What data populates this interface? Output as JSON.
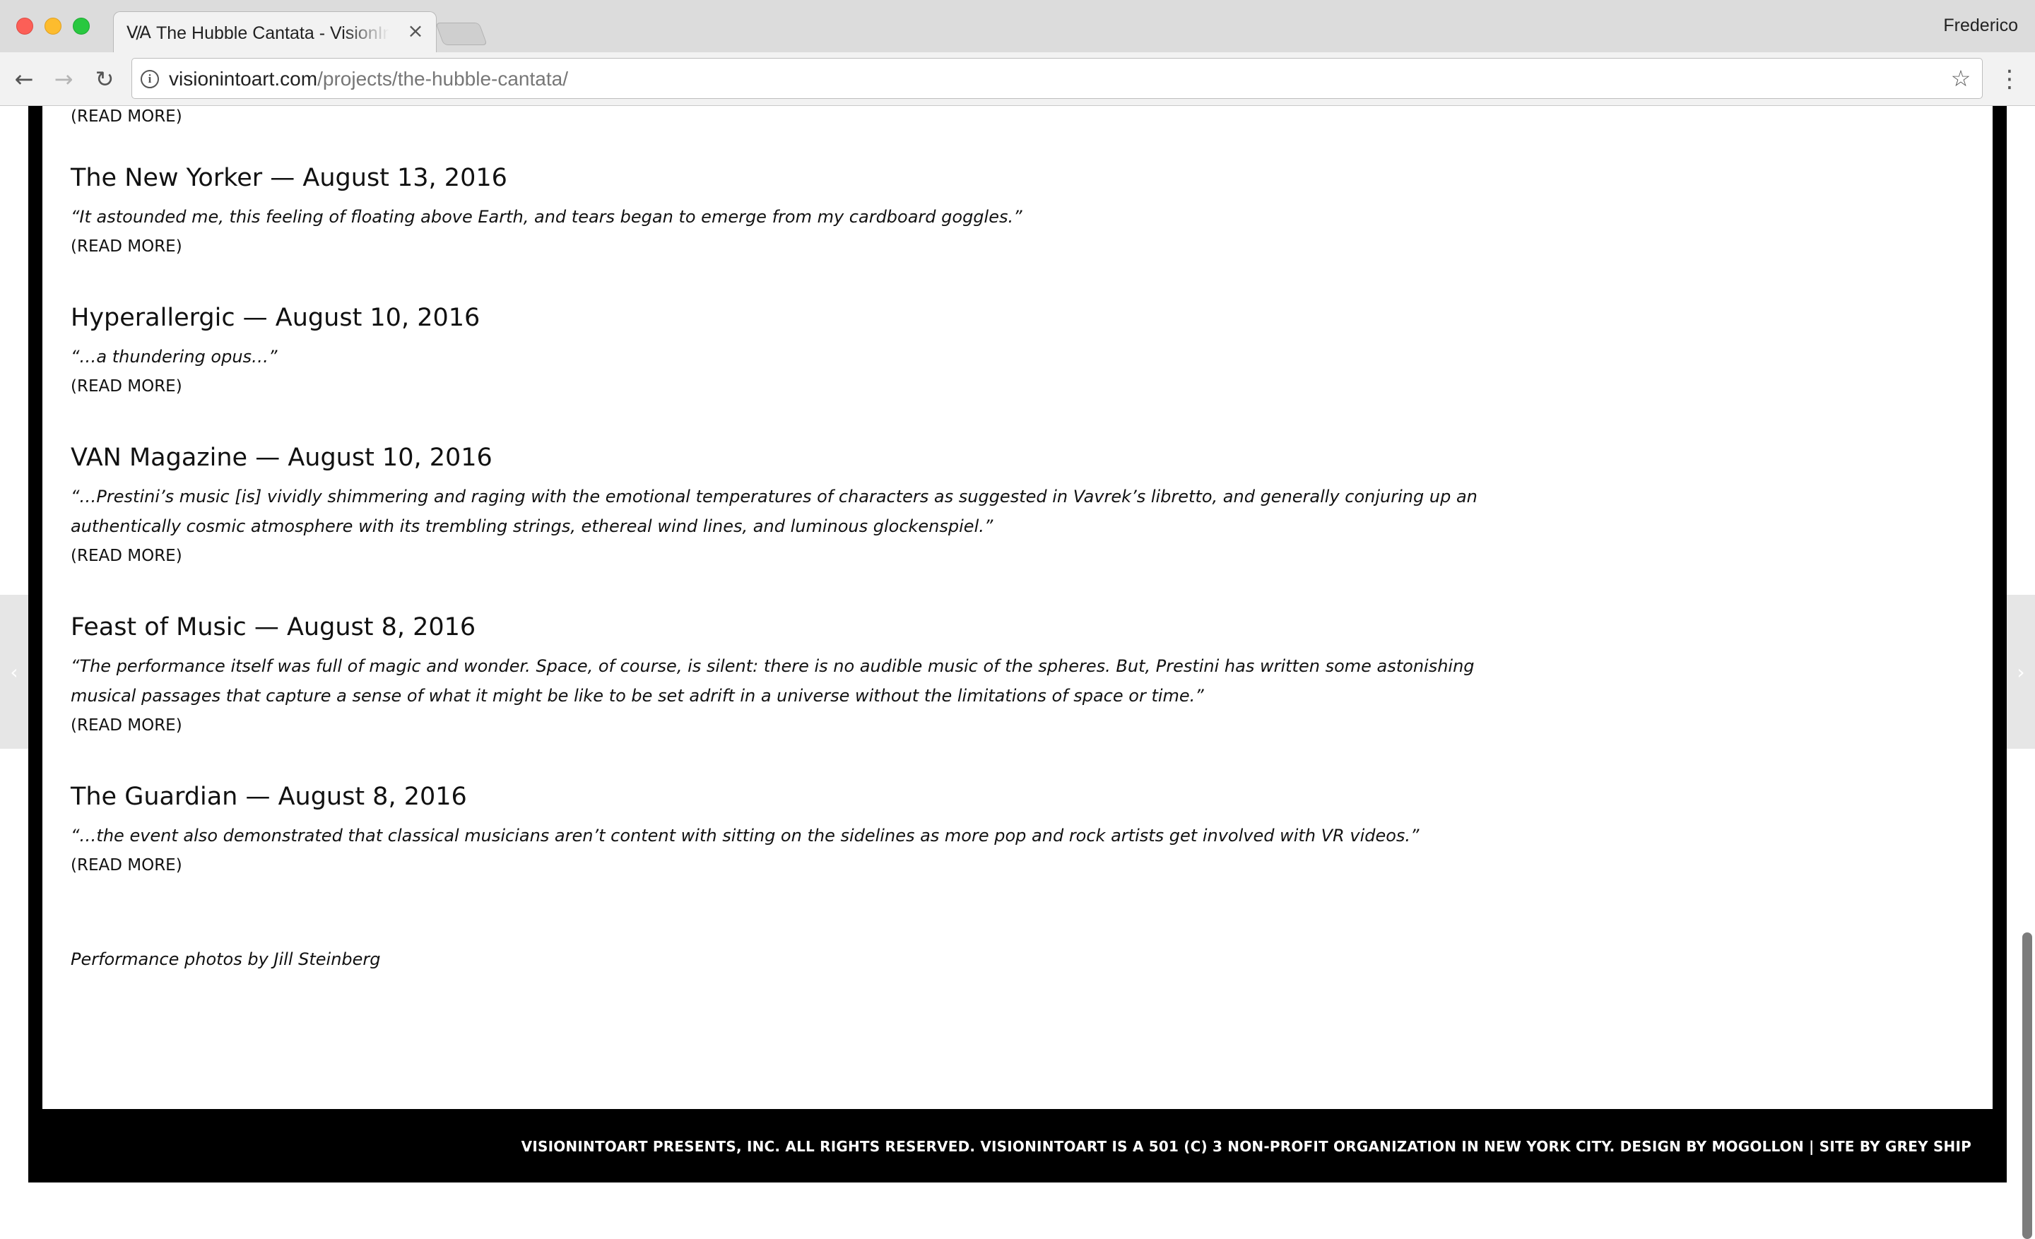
{
  "browser": {
    "tab_title": "The Hubble Cantata - VisionIntoArt",
    "tab_favicon": "V/A",
    "tab_close_glyph": "×",
    "profile_name": "Frederico",
    "url_host": "visionintoart.com",
    "url_path": "/projects/the-hubble-cantata/",
    "icons": {
      "back": "arrow-left-icon",
      "forward": "arrow-right-icon",
      "reload": "reload-icon",
      "info": "info-icon",
      "bookmark": "star-icon",
      "menu": "kebab-menu-icon"
    },
    "colors": {
      "close": "#fc5f57",
      "minimize": "#fdbc2e",
      "zoom": "#29c840"
    }
  },
  "page": {
    "read_more_label": "(READ MORE)",
    "press": [
      {
        "heading": "The New Yorker — August 13, 2016",
        "quote": "“It astounded me, this feeling of floating above Earth, and tears began to emerge from my cardboard goggles.”",
        "read_more": "(READ MORE)"
      },
      {
        "heading": "Hyperallergic — August 10, 2016",
        "quote": "“…a thundering opus…”",
        "read_more": "(READ MORE)"
      },
      {
        "heading": "VAN Magazine — August 10, 2016",
        "quote": "“…Prestini’s music [is] vividly shimmering and raging with the emotional temperatures of characters as suggested in Vavrek’s libretto, and generally conjuring up an authentically cosmic atmosphere with its trembling strings, ethereal wind lines, and luminous glockenspiel.”",
        "read_more": "(READ MORE)"
      },
      {
        "heading": "Feast of Music — August 8, 2016",
        "quote": "“The performance itself was full of magic and wonder. Space, of course, is silent: there is no audible music of the spheres. But, Prestini has written some astonishing musical passages that capture a sense of what it might be like to be set adrift in a universe without the limitations of space or time.”",
        "read_more": "(READ MORE)"
      },
      {
        "heading": "The Guardian — August 8, 2016",
        "quote": "“…the event also demonstrated that classical musicians aren’t content with sitting on the sidelines as more pop and rock artists get involved with VR videos.”",
        "read_more": "(READ MORE)"
      }
    ],
    "credit": "Performance photos by Jill Steinberg",
    "footer": "VISIONINTOART PRESENTS, INC. ALL RIGHTS RESERVED. VISIONINTOART IS A 501 (C) 3 NON-PROFIT ORGANIZATION IN NEW YORK CITY. DESIGN BY MOGOLLON | SITE BY GREY SHIP",
    "slider_prev_glyph": "‹",
    "slider_next_glyph": "›"
  }
}
